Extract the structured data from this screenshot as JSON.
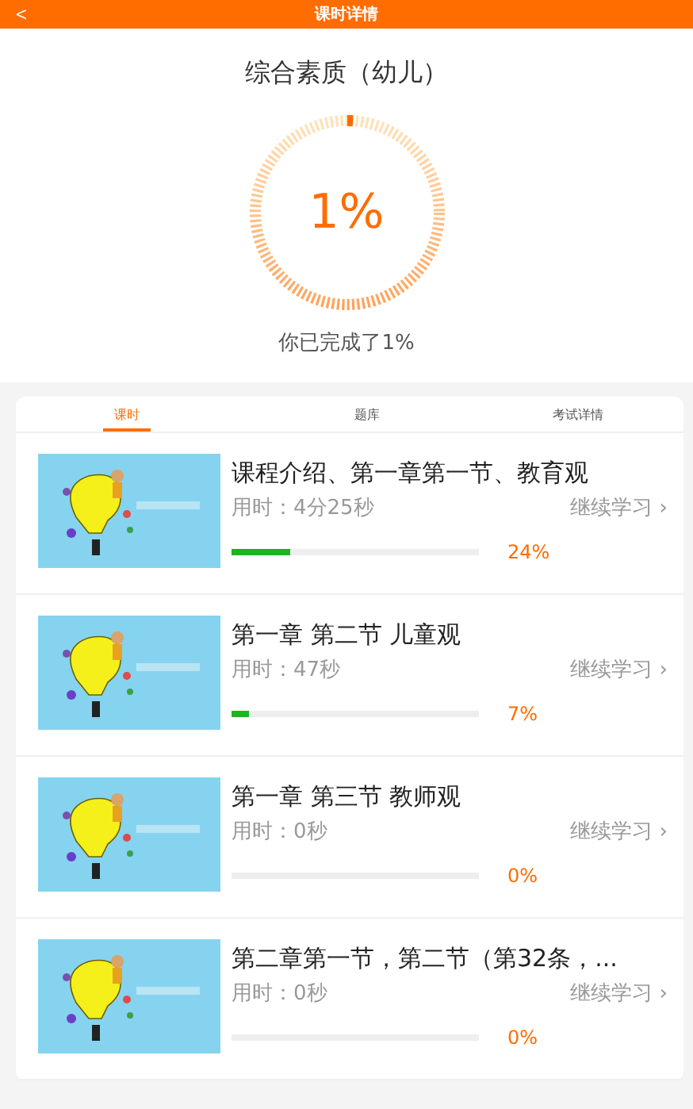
{
  "header": {
    "back": "<",
    "title": "课时详情"
  },
  "course": {
    "title": "综合素质（幼儿）",
    "progress": {
      "label": "1%",
      "level": 0.01
    },
    "summary": "你已完成了1%"
  },
  "tabs": [
    {
      "label": "课时",
      "selected": true
    },
    {
      "label": "题库",
      "selected": false
    },
    {
      "label": "考试详情",
      "selected": false
    }
  ],
  "lessons": [
    {
      "title": "课程介绍、第一章第一节、教育观",
      "time": "用时：4分25秒",
      "action": "继续学习 ›",
      "level": 0.24,
      "percent": "24%"
    },
    {
      "title": "第一章 第二节 儿童观",
      "time": "用时：47秒",
      "action": "继续学习 ›",
      "level": 0.07,
      "percent": "7%"
    },
    {
      "title": "第一章 第三节 教师观",
      "time": "用时：0秒",
      "action": "继续学习 ›",
      "percent": "0%"
    },
    {
      "title": "第二章第一节，第二节（第32条，...",
      "time": "用时：0秒",
      "action": "继续学习 ›",
      "percent": "0%"
    }
  ]
}
